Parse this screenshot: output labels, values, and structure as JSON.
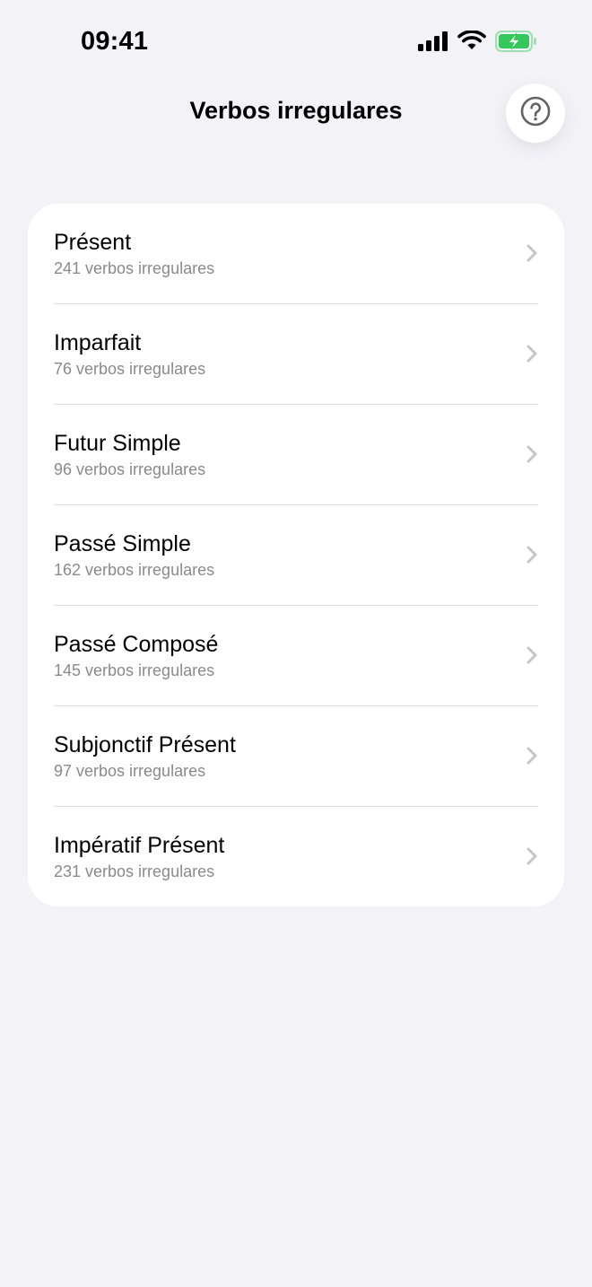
{
  "status_bar": {
    "time": "09:41",
    "icons": [
      "cellular-signal-icon",
      "wifi-icon",
      "battery-charging-icon"
    ]
  },
  "header": {
    "title": "Verbos irregulares",
    "help_icon": "question-circle-icon"
  },
  "tenses": [
    {
      "title": "Présent",
      "subtitle": "241 verbos irregulares"
    },
    {
      "title": "Imparfait",
      "subtitle": "76 verbos irregulares"
    },
    {
      "title": "Futur Simple",
      "subtitle": "96 verbos irregulares"
    },
    {
      "title": "Passé Simple",
      "subtitle": "162 verbos irregulares"
    },
    {
      "title": "Passé Composé",
      "subtitle": "145 verbos irregulares"
    },
    {
      "title": "Subjonctif Présent",
      "subtitle": "97 verbos irregulares"
    },
    {
      "title": "Impératif Présent",
      "subtitle": "231 verbos irregulares"
    }
  ],
  "colors": {
    "background": "#f2f2f7",
    "card": "#ffffff",
    "secondary_text": "#8a8a8e",
    "separator": "#dcdce1",
    "chevron": "#c4c4c7",
    "battery_fill": "#34c759"
  }
}
